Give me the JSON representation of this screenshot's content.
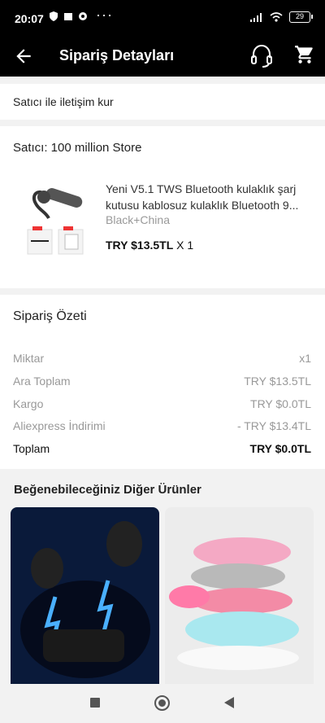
{
  "status_bar": {
    "time": "20:07",
    "more": "···",
    "battery": "29"
  },
  "app_bar": {
    "title": "Sipariş Detayları"
  },
  "contact": {
    "label": "Satıcı ile iletişim kur"
  },
  "seller": {
    "label": "Satıcı: 100 million Store"
  },
  "product": {
    "title_line1": "Yeni V5.1 TWS Bluetooth kulaklık şarj",
    "title_line2": "kutusu kablosuz kulaklık Bluetooth 9...",
    "variant": "Black+China",
    "price": "TRY $13.5TL",
    "quantity": "X 1"
  },
  "summary": {
    "title": "Sipariş Özeti",
    "rows": [
      {
        "label": "Miktar",
        "value": "x1"
      },
      {
        "label": "Ara Toplam",
        "value": "TRY $13.5TL"
      },
      {
        "label": "Kargo",
        "value": "TRY $0.0TL"
      },
      {
        "label": "Aliexpress İndirimi",
        "value": "- TRY $13.4TL"
      },
      {
        "label": "Toplam",
        "value": "TRY $0.0TL"
      }
    ]
  },
  "recommendations": {
    "title": "Beğenebileceğiniz Diğer Ürünler"
  },
  "colors": {
    "bar": "#000000",
    "card": "#ffffff",
    "background": "#f2f2f2",
    "muted": "#999999"
  },
  "icons": [
    "back-arrow-icon",
    "support-headset-icon",
    "cart-icon"
  ]
}
